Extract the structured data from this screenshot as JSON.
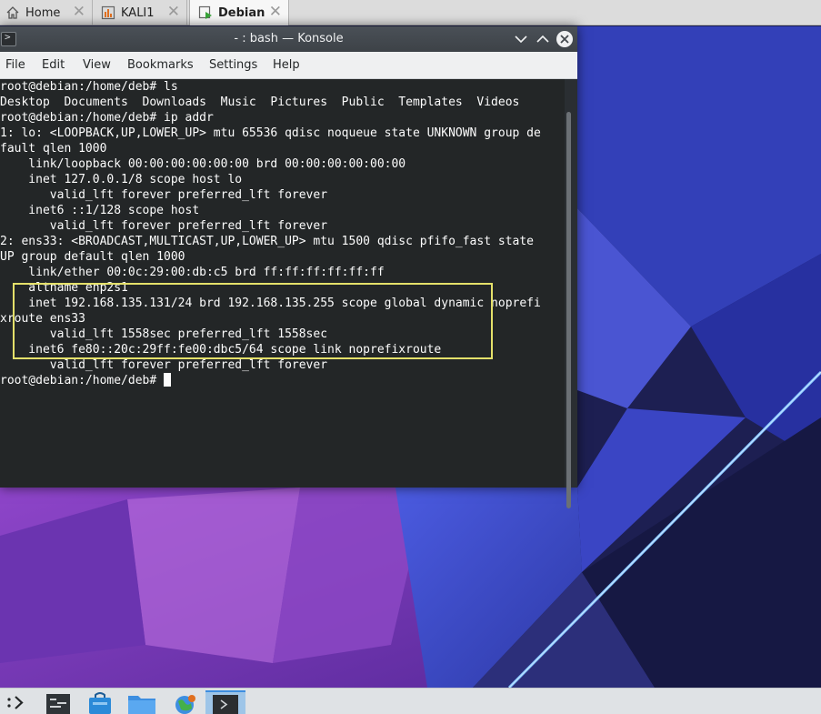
{
  "vm_tabs": [
    {
      "label": "Home",
      "icon": "home-icon"
    },
    {
      "label": "KALI1",
      "icon": "vm-icon"
    },
    {
      "label": "Debian",
      "icon": "vm-running-icon",
      "active": true
    }
  ],
  "tab_close_glyph": "✕",
  "window": {
    "title": "- : bash — Konsole",
    "icon_glyph": ">"
  },
  "menu": [
    "File",
    "Edit",
    "View",
    "Bookmarks",
    "Settings",
    "Help"
  ],
  "terminal_lines": [
    "root@debian:/home/deb# ls",
    "Desktop  Documents  Downloads  Music  Pictures  Public  Templates  Videos",
    "root@debian:/home/deb# ip addr",
    "1: lo: <LOOPBACK,UP,LOWER_UP> mtu 65536 qdisc noqueue state UNKNOWN group de",
    "fault qlen 1000",
    "    link/loopback 00:00:00:00:00:00 brd 00:00:00:00:00:00",
    "    inet 127.0.0.1/8 scope host lo",
    "       valid_lft forever preferred_lft forever",
    "    inet6 ::1/128 scope host",
    "       valid_lft forever preferred_lft forever",
    "2: ens33: <BROADCAST,MULTICAST,UP,LOWER_UP> mtu 1500 qdisc pfifo_fast state",
    "UP group default qlen 1000",
    "    link/ether 00:0c:29:00:db:c5 brd ff:ff:ff:ff:ff:ff",
    "    altname enp2s1",
    "    inet 192.168.135.131/24 brd 192.168.135.255 scope global dynamic noprefi",
    "xroute ens33",
    "       valid_lft 1558sec preferred_lft 1558sec",
    "    inet6 fe80::20c:29ff:fe00:dbc5/64 scope link noprefixroute",
    "       valid_lft forever preferred_lft forever",
    "root@debian:/home/deb# "
  ],
  "colors": {
    "terminal_bg": "#232627",
    "terminal_fg": "#fcfcfc",
    "highlight": "#e4e06a",
    "titlebar": "#43484d",
    "wallpaper_dark": "#1b1e4a",
    "wallpaper_purple": "#7a3bb5",
    "wallpaper_blue": "#3f4fd0"
  },
  "taskbar": [
    {
      "name": "app-launcher-icon"
    },
    {
      "name": "system-settings-icon"
    },
    {
      "name": "discover-store-icon"
    },
    {
      "name": "dolphin-folder-icon"
    },
    {
      "name": "web-browser-icon"
    },
    {
      "name": "konsole-task-icon",
      "active": true
    }
  ]
}
